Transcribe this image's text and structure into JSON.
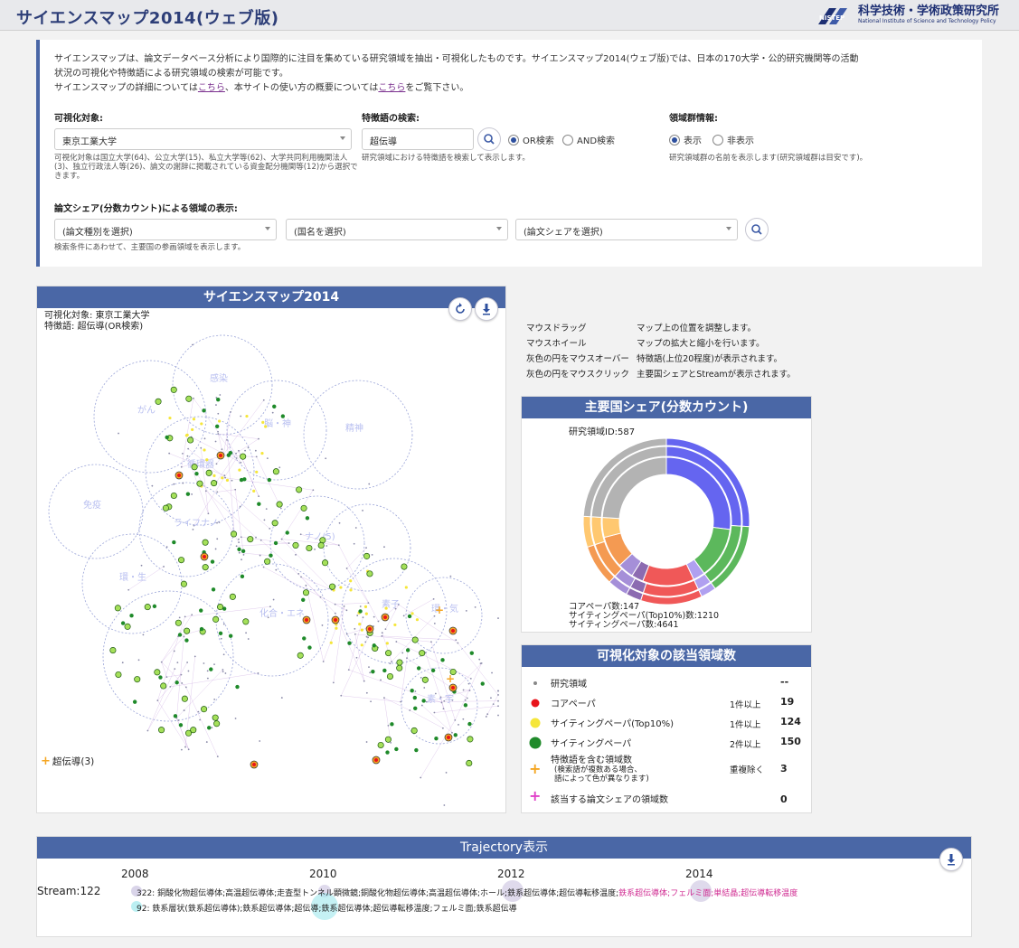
{
  "header": {
    "title": "サイエンスマップ2014(ウェブ版)",
    "logo_main": "科学技術・学術政策研究所",
    "logo_sub": "National Institute of Science and Technology Policy",
    "logo_mark": "NISTEP"
  },
  "intro": {
    "line1": "サイエンスマップは、論文データベース分析により国際的に注目を集めている研究領域を抽出・可視化したものです。サイエンスマップ2014(ウェブ版)では、日本の170大学・公的研究機関等の活動",
    "line2": "状況の可視化や特徴語による研究領域の検索が可能です。",
    "line3_pre": "サイエンスマップの詳細については",
    "link1": "こちら",
    "line3_mid": "、本サイトの使い方の概要については",
    "link2": "こちら",
    "line3_post": "をご覧下さい。"
  },
  "target": {
    "label": "可視化対象:",
    "value": "東京工業大学",
    "note": "可視化対象は国立大学(64)、公立大学(15)、私立大学等(62)、大学共同利用機関法人(3)、独立行政法人等(26)、論文の謝辞に掲載されている資金配分機関等(12)から選択できます。"
  },
  "keyword": {
    "label": "特徴語の検索:",
    "value": "超伝導",
    "or_label": "OR検索",
    "and_label": "AND検索",
    "note": "研究領域における特徴語を検索して表示します。"
  },
  "group": {
    "label": "領域群情報:",
    "show_label": "表示",
    "hide_label": "非表示",
    "note": "研究領域群の名前を表示します(研究領域群は目安です)。"
  },
  "share_filter": {
    "label": "論文シェア(分数カウント)による領域の表示:",
    "paper_type": "(論文種別を選択)",
    "country": "(国名を選択)",
    "share": "(論文シェアを選択)",
    "note": "検索条件にあわせて、主要国の参画領域を表示します。"
  },
  "map": {
    "title": "サイエンスマップ2014",
    "meta1": "可視化対象: 東京工業大学",
    "meta2": "特徴語: 超伝導(OR検索)",
    "legend_keyword": "超伝導(3)",
    "regions": [
      "がん",
      "感染",
      "脳・神",
      "精神",
      "免疫",
      "循環器",
      "ライフナノ",
      "ナノ(5)",
      "環・生",
      "化合・エネ",
      "素子",
      "環・気",
      "素・宇"
    ]
  },
  "help": [
    {
      "key": "マウスドラッグ",
      "desc": "マップ上の位置を調整します。"
    },
    {
      "key": "マウスホイール",
      "desc": "マップの拡大と縮小を行います。"
    },
    {
      "key": "灰色の円をマウスオーバー",
      "desc": "特徴語(上位20程度)が表示されます。"
    },
    {
      "key": "灰色の円をマウスクリック",
      "desc": "主要国シェアとStreamが表示されます。"
    }
  ],
  "share_card": {
    "title": "主要国シェア(分数カウント)",
    "area_id": "研究領域ID:587",
    "core": "コアペーパ数:147",
    "citing_top": "サイティングペーパ(Top10%)数:1210",
    "citing": "サイティングペーパ数:4641"
  },
  "count_card": {
    "title": "可視化対象の該当領域数",
    "rows": [
      {
        "label": "研究領域",
        "threshold": "",
        "value": "--",
        "color": "#888888"
      },
      {
        "label": "コアペーパ",
        "threshold": "1件以上",
        "value": "19",
        "color": "#e8141b"
      },
      {
        "label": "サイティングペーパ(Top10%)",
        "threshold": "1件以上",
        "value": "124",
        "color": "#f5e63a"
      },
      {
        "label": "サイティングペーパ",
        "threshold": "2件以上",
        "value": "150",
        "color": "#1f8a2a"
      }
    ],
    "kw_label": "特徴語を含む領域数",
    "kw_note1": "(検索語が複数ある場合、",
    "kw_note2": "語によって色が異なります)",
    "kw_threshold": "重複除く",
    "kw_value": "3",
    "share_label": "該当する論文シェアの領域数",
    "share_value": "0",
    "kw_color": "#f5a623",
    "share_color": "#e040c8"
  },
  "trajectory": {
    "title": "Trajectory表示",
    "years": [
      "2008",
      "2010",
      "2012",
      "2014"
    ],
    "stream_label": "Stream:122",
    "line1": "322: 銅酸化物超伝導体;高温超伝導体;走査型トンネル顕微鏡;銅酸化物超伝導体;高温超伝導体;ホール;鉄系超伝導体;超伝導転移温度;",
    "line1_pink": "鉄系超伝導体;フェルミ面;単結晶;超伝導転移温度",
    "line2": "92: 鉄系層状(鉄系超伝導体);鉄系超伝導体;超伝導;鉄系超伝導体;超伝導転移温度;フェルミ面;鉄系超伝導"
  },
  "colors": {
    "header_blue": "#4a67a6",
    "title_blue": "#2d3e78",
    "network_purple": "#b98ad6",
    "cluster_dash": "#9aa4d8"
  },
  "chart_data": {
    "type": "pie",
    "title": "主要国シェア(分数カウント)",
    "rings": [
      {
        "name": "outer",
        "values": [
          26,
          14,
          3,
          12,
          3,
          4,
          8,
          6,
          24
        ]
      },
      {
        "name": "middle",
        "values": [
          26,
          14,
          3,
          12,
          3,
          4,
          8,
          6,
          24
        ]
      },
      {
        "name": "inner",
        "values": [
          27,
          13,
          3,
          13,
          3,
          4,
          8,
          5,
          24
        ]
      }
    ],
    "slice_colors": [
      "#6565f0",
      "#5cb85c",
      "#b0a0f0",
      "#f05858",
      "#8c6bb1",
      "#a58fd8",
      "#f49a52",
      "#ffc870",
      "#b3b3b3"
    ]
  }
}
